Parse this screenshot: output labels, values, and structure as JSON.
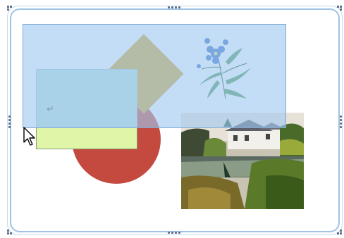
{
  "canvas": {
    "text_box_return_mark": "↵"
  },
  "colors": {
    "selection": "#a0c8f0",
    "diamond": "#d4a630",
    "circle": "#c44a40",
    "text_box_fill": "#dff5a8",
    "frame": "#9fc3e6"
  },
  "icons": {
    "cursor": "arrow-pointer-icon",
    "flower": "flower-clipart-icon"
  }
}
